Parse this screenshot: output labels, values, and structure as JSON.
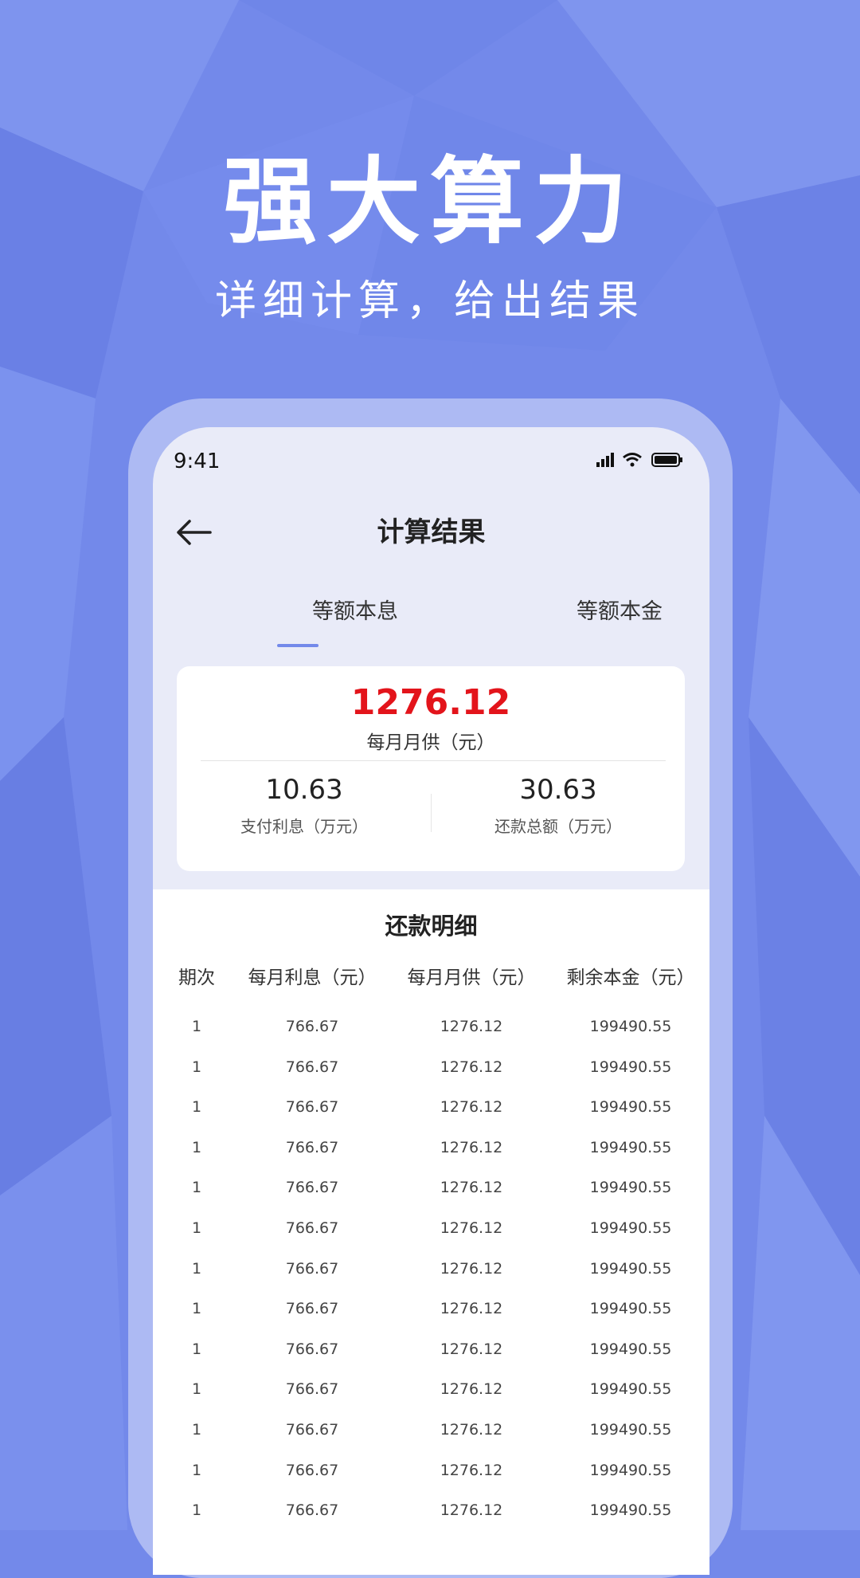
{
  "hero": {
    "title": "强大算力",
    "subtitle": "详细计算，给出结果"
  },
  "status_bar": {
    "time": "9:41",
    "icons": [
      "cellular-signal-icon",
      "wifi-icon",
      "battery-icon"
    ]
  },
  "nav": {
    "back_icon": "arrow-left-icon",
    "title": "计算结果"
  },
  "tabs": [
    {
      "label": "等额本息",
      "active": true
    },
    {
      "label": "等额本金",
      "active": false
    }
  ],
  "summary": {
    "monthly_payment": "1276.12",
    "monthly_payment_label": "每月月供（元）",
    "interest_value": "10.63",
    "interest_label": "支付利息（万元）",
    "total_value": "30.63",
    "total_label": "还款总额（万元）"
  },
  "detail": {
    "title": "还款明细",
    "columns": [
      "期次",
      "每月利息（元）",
      "每月月供（元）",
      "剩余本金（元）"
    ],
    "rows": [
      [
        "1",
        "766.67",
        "1276.12",
        "199490.55"
      ],
      [
        "1",
        "766.67",
        "1276.12",
        "199490.55"
      ],
      [
        "1",
        "766.67",
        "1276.12",
        "199490.55"
      ],
      [
        "1",
        "766.67",
        "1276.12",
        "199490.55"
      ],
      [
        "1",
        "766.67",
        "1276.12",
        "199490.55"
      ],
      [
        "1",
        "766.67",
        "1276.12",
        "199490.55"
      ],
      [
        "1",
        "766.67",
        "1276.12",
        "199490.55"
      ],
      [
        "1",
        "766.67",
        "1276.12",
        "199490.55"
      ],
      [
        "1",
        "766.67",
        "1276.12",
        "199490.55"
      ],
      [
        "1",
        "766.67",
        "1276.12",
        "199490.55"
      ],
      [
        "1",
        "766.67",
        "1276.12",
        "199490.55"
      ],
      [
        "1",
        "766.67",
        "1276.12",
        "199490.55"
      ],
      [
        "1",
        "766.67",
        "1276.12",
        "199490.55"
      ]
    ]
  },
  "colors": {
    "background": "#7389ea",
    "accent": "#7389ea",
    "highlight_red": "#e3141b",
    "screen_bg": "#e9ebf8"
  }
}
